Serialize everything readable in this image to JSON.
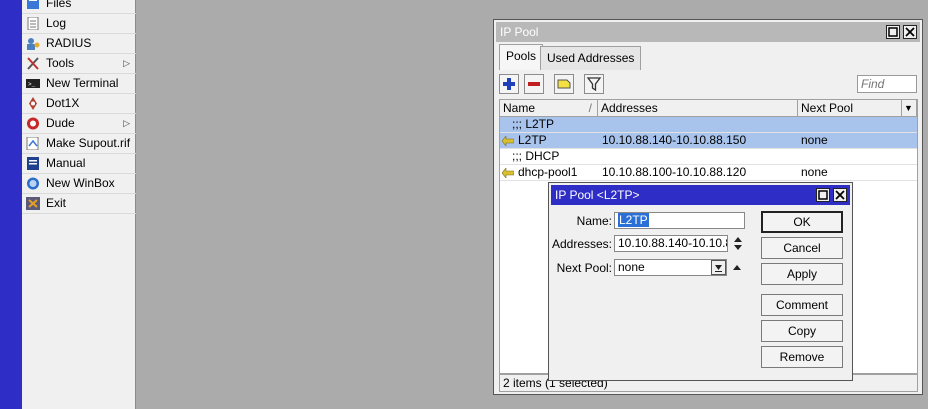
{
  "sidemenu": {
    "items": [
      {
        "label": "Files",
        "icon": "files-icon"
      },
      {
        "label": "Log",
        "icon": "log-icon"
      },
      {
        "label": "RADIUS",
        "icon": "radius-icon"
      },
      {
        "label": "Tools",
        "icon": "tools-icon",
        "submenu": true
      },
      {
        "label": "New Terminal",
        "icon": "terminal-icon"
      },
      {
        "label": "Dot1X",
        "icon": "dot1x-icon"
      },
      {
        "label": "Dude",
        "icon": "dude-icon",
        "submenu": true
      },
      {
        "label": "Make Supout.rif",
        "icon": "supout-icon"
      },
      {
        "label": "Manual",
        "icon": "manual-icon"
      },
      {
        "label": "New WinBox",
        "icon": "winbox-icon"
      },
      {
        "label": "Exit",
        "icon": "exit-icon"
      }
    ]
  },
  "window": {
    "title": "IP Pool",
    "tabs": [
      {
        "label": "Pools",
        "active": true
      },
      {
        "label": "Used Addresses",
        "active": false
      }
    ],
    "find_placeholder": "Find",
    "columns": [
      {
        "label": "Name"
      },
      {
        "label": "Addresses"
      },
      {
        "label": "Next Pool"
      }
    ],
    "rows": [
      {
        "type": "comment",
        "text": ";;; L2TP",
        "selected": true
      },
      {
        "type": "data",
        "name": "L2TP",
        "addresses": "10.10.88.140-10.10.88.150",
        "next_pool": "none",
        "selected": true
      },
      {
        "type": "comment",
        "text": ";;; DHCP",
        "selected": false
      },
      {
        "type": "data",
        "name": "dhcp-pool1",
        "addresses": "10.10.88.100-10.10.88.120",
        "next_pool": "none",
        "selected": false
      }
    ],
    "status": "2 items (1 selected)"
  },
  "dialog": {
    "title": "IP Pool <L2TP>",
    "fields": {
      "name_label": "Name:",
      "name_value": "L2TP",
      "addresses_label": "Addresses:",
      "addresses_value": "10.10.88.140-10.10.88",
      "next_pool_label": "Next Pool:",
      "next_pool_value": "none"
    },
    "buttons": {
      "ok": "OK",
      "cancel": "Cancel",
      "apply": "Apply",
      "comment": "Comment",
      "copy": "Copy",
      "remove": "Remove"
    }
  },
  "colors": {
    "accent": "#2e2ec6",
    "selection": "#a8c4ec",
    "desktop": "#ababab",
    "inactive_title": "#b8b8b8"
  }
}
